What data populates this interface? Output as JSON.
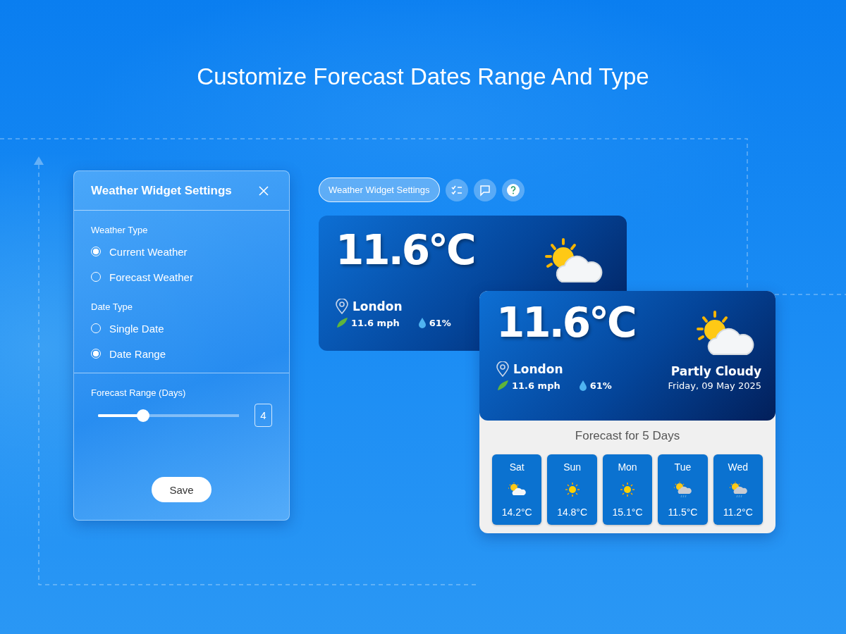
{
  "headline": "Customize Forecast Dates Range And Type",
  "settings_panel": {
    "title": "Weather Widget Settings",
    "groups": [
      {
        "label": "Weather Type",
        "options": [
          {
            "label": "Current Weather",
            "selected": true
          },
          {
            "label": "Forecast Weather",
            "selected": false
          }
        ]
      },
      {
        "label": "Date Type",
        "options": [
          {
            "label": "Single Date",
            "selected": false
          },
          {
            "label": "Date Range",
            "selected": true
          }
        ]
      }
    ],
    "range": {
      "label": "Forecast Range (Days)",
      "level": 0.3,
      "value": "4"
    },
    "save_button": "Save"
  },
  "toolbar": {
    "label": "Weather Widget Settings"
  },
  "current_card": {
    "temperature": "11.6°C",
    "city": "London",
    "wind": "11.6 mph",
    "humidity": "61%"
  },
  "forecast_card": {
    "temperature": "11.6°C",
    "city": "London",
    "wind": "11.6 mph",
    "humidity": "61%",
    "condition": "Partly Cloudy",
    "date": "Friday, 09 May 2025",
    "forecast_title": "Forecast for 5 Days",
    "days": [
      {
        "day": "Sat",
        "kind": "partly-cloudy",
        "temperature": "14.2°C"
      },
      {
        "day": "Sun",
        "kind": "sunny",
        "temperature": "14.8°C"
      },
      {
        "day": "Mon",
        "kind": "sunny",
        "temperature": "15.1°C"
      },
      {
        "day": "Tue",
        "kind": "showers",
        "temperature": "11.5°C"
      },
      {
        "day": "Wed",
        "kind": "showers",
        "temperature": "11.2°C"
      }
    ]
  }
}
